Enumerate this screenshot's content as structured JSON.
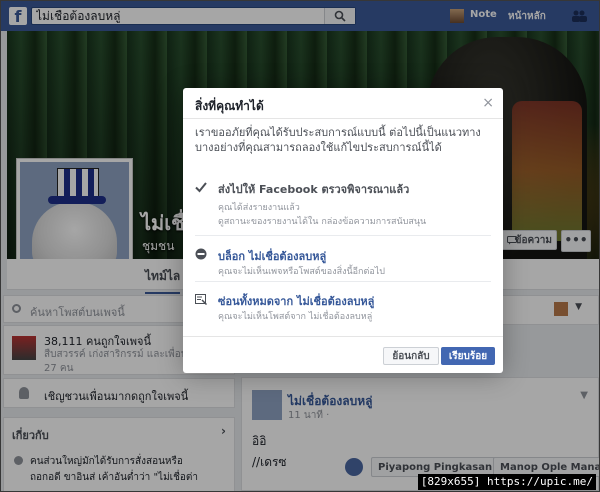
{
  "topbar": {
    "search_value": "ไม่เชื่อต้องลบหลู่",
    "note_label": "Note",
    "home_label": "หน้าหลัก"
  },
  "page": {
    "name": "ไม่เชื่",
    "category": "ชุมชน",
    "message_button": "ข้อความ",
    "more_button": "•••",
    "timeline_tab": "ไทม์ไล"
  },
  "left": {
    "search_posts_placeholder": "ค้นหาโพสต์บนเพจนี้",
    "likes_count": "38,111 คนถูกใจเพจนี้",
    "likes_friends": "สืบสวรรค์ เก่งสาริกรรม์ และเพื่อน",
    "likes_more": "27 คน",
    "invite_label": "เชิญชวนเพื่อนมากดถูกใจเพจนี้",
    "about_header": "เกี่ยวกับ",
    "about_chevron": "›",
    "about_line1": "คนส่วนใหญ่มักได้รับการสั่งสอนหรือ",
    "about_line2": "ถอกอดี ขาอินส่ เค้าอันต่ำว่า \"ไม่เชื่อต่า"
  },
  "post": {
    "author": "ไม่เชื่อต้องลบหลู่",
    "time": "11 นาที · ",
    "text1": "อิอิ",
    "text2": "//เดรซ",
    "chip1": "Piyapong Pingkasan",
    "chip2": "Manop Ople Manas..."
  },
  "dialog": {
    "title": "สิ่งที่คุณทำได้",
    "close": "×",
    "intro": "เราขออภัยที่คุณได้รับประสบการณ์แบบนี้ ต่อไปนี้เป็นแนวทางบางอย่างที่คุณสามารถลองใช้แก้ไขประสบการณ์นี้ได้",
    "options": [
      {
        "icon": "check-icon",
        "title": "ส่งไปให้ Facebook ตรวจพิจารณาแล้ว",
        "sub": "คุณได้ส่งรายงานแล้ว",
        "sub2": "ดูสถานะของรายงานได้ใน กล่องข้อความการสนับสนุน"
      },
      {
        "icon": "block-icon",
        "title": "บล็อก ไม่เชื่อต้องลบหลู่",
        "sub": "คุณจะไม่เห็นเพจหรือโพสต์ของสิ่งนี้อีกต่อไป"
      },
      {
        "icon": "hide-icon",
        "title": "ซ่อนทั้งหมดจาก ไม่เชื่อต้องลบหลู่",
        "sub": "คุณจะไม่เห็นโพสต์จาก ไม่เชื่อต้องลบหลู่"
      }
    ],
    "back_button": "ย้อนกลับ",
    "done_button": "เรียบร้อย"
  },
  "watermark": "[829x655] https://upic.me/",
  "colors": {
    "brand": "#3b5998",
    "link": "#365899",
    "primary_button": "#4267b2"
  }
}
